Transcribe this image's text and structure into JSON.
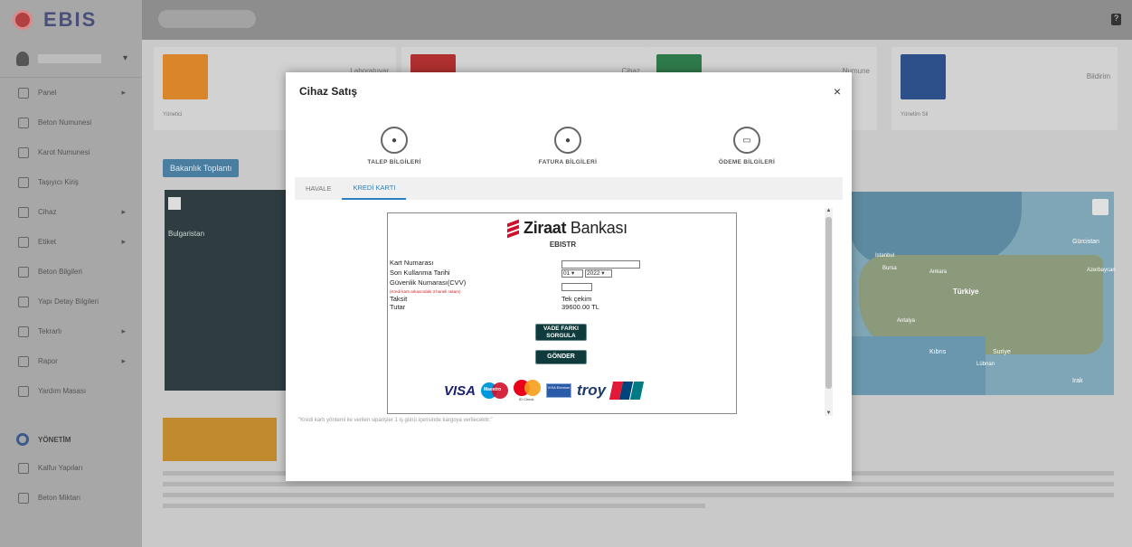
{
  "app": {
    "logo_text": "EBIS"
  },
  "sidebar": {
    "items": [
      {
        "label": "Panel",
        "icon": "dashboard-icon",
        "caret": true
      },
      {
        "label": "Beton Numunesi",
        "icon": "cube-icon",
        "caret": false
      },
      {
        "label": "Karot Numunesi",
        "icon": "cylinder-icon",
        "caret": false
      },
      {
        "label": "Taşıyıcı Kiriş",
        "icon": "beam-icon",
        "caret": false
      },
      {
        "label": "Cihaz",
        "icon": "device-icon",
        "caret": true
      },
      {
        "label": "Etiket",
        "icon": "tag-icon",
        "caret": true
      },
      {
        "label": "Beton Bilgileri",
        "icon": "document-icon",
        "caret": false
      },
      {
        "label": "Yapı Detay Bilgileri",
        "icon": "building-icon",
        "caret": false
      },
      {
        "label": "Tekrarlı",
        "icon": "repeat-icon",
        "caret": true
      },
      {
        "label": "Rapor",
        "icon": "report-icon",
        "caret": true
      },
      {
        "label": "Yardım Masası",
        "icon": "help-icon",
        "caret": false
      }
    ],
    "section_label": "YÖNETİM",
    "section_items": [
      {
        "label": "Kalfuı Yapıları",
        "icon": "building-icon"
      },
      {
        "label": "Beton Miktarı",
        "icon": "list-icon"
      }
    ]
  },
  "dashboard": {
    "cards": [
      {
        "label": "Laboratuvar",
        "sub": "Yönetici",
        "color": "#d9852a"
      },
      {
        "label": "Cihaz",
        "sub": "",
        "color": "#b03030"
      },
      {
        "label": "Numune",
        "sub": "",
        "color": "#2f7a4a"
      },
      {
        "label": "Bildirim",
        "sub": "Yönetim Sil",
        "color": "#2d4f8a"
      }
    ],
    "map_button": "Bakanlık Toplantı",
    "map_left_label": "Bulgaristan",
    "map_right_labels": [
      "Istanbul",
      "Bursa",
      "Ankara",
      "Türkiye",
      "Antalya",
      "Kıbrıs",
      "Suriye",
      "Lübnan",
      "Irak",
      "Gürcistan",
      "Azerbaycan"
    ]
  },
  "modal": {
    "title": "Cihaz Satış",
    "close_symbol": "×",
    "steps": [
      {
        "label": "TALEP BİLGİLERİ",
        "icon": "leaf-icon"
      },
      {
        "label": "FATURA BİLGİLERİ",
        "icon": "leaf-icon"
      },
      {
        "label": "ÖDEME BİLGİLERİ",
        "icon": "card-icon"
      }
    ],
    "tabs": [
      {
        "label": "HAVALE",
        "active": false
      },
      {
        "label": "KREDİ KARTI",
        "active": true
      }
    ],
    "payment": {
      "bank_name_prefix": "Ziraat",
      "bank_name_suffix": "Bankası",
      "merchant": "EBISTR",
      "fields": {
        "card_number_label": "Kart Numarası",
        "card_number_value": "",
        "expiry_label": "Son Kullanma Tarihi",
        "expiry_month": "01",
        "expiry_year": "2022",
        "cvv_label": "Güvenlik Numarası(CVV)",
        "cvv_note": "(Kredi kartı arkasındaki 3 haneli rakam)",
        "cvv_value": "",
        "installment_label": "Taksit",
        "installment_value": "Tek çekim",
        "amount_label": "Tutar",
        "amount_value": "39600.00 TL"
      },
      "query_button": "VADE FARKI SORGULA",
      "submit_button": "GÖNDER",
      "card_brands": [
        "VISA",
        "Maestro",
        "MasterCard",
        "Electron",
        "troy",
        "UnionPay"
      ],
      "mastercard_subtext": "ID Check",
      "electron_text": "VISA Electron",
      "unionpay_text": "UnionPay 银联"
    },
    "footer_note": "\"Kredi kartı yöntemi ile verilen siparişler 1 iş günü içerisinde kargoya verilecektir.\""
  },
  "colors": {
    "active_tab": "#2e7fc1",
    "dark_button": "#0f3b3c",
    "bank_red": "#d0102a"
  }
}
